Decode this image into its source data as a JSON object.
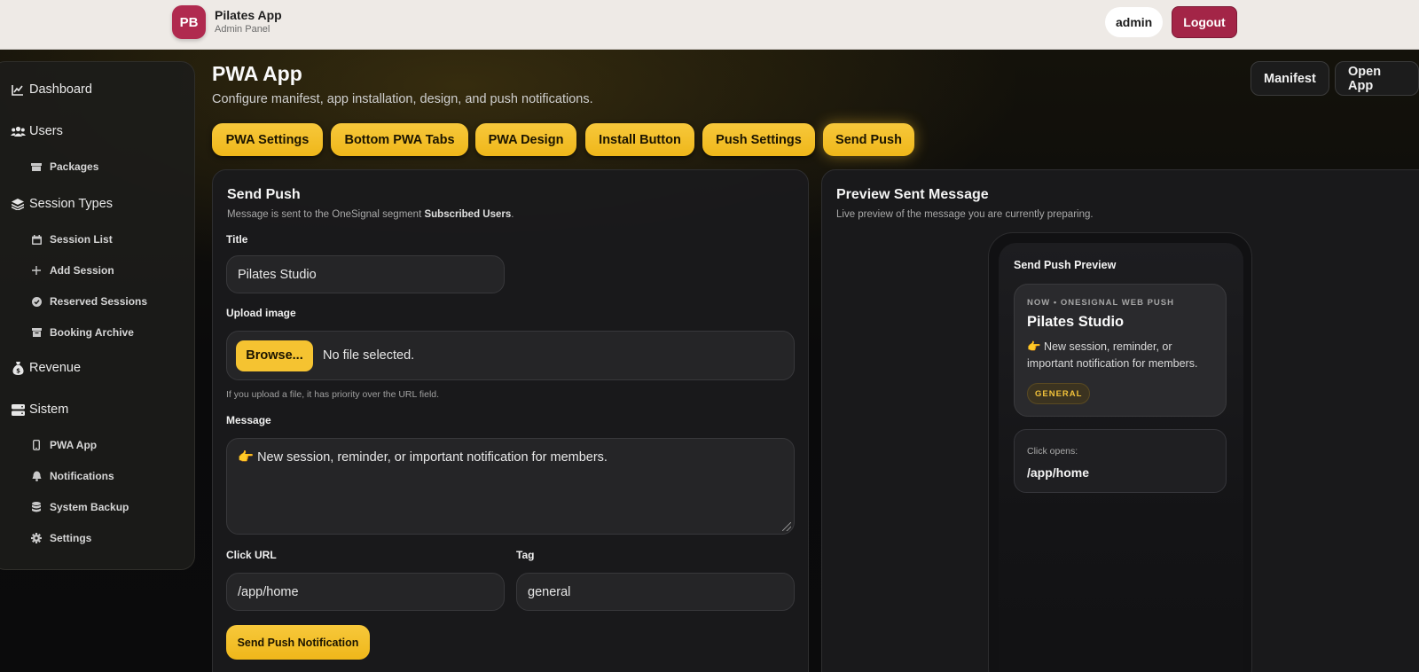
{
  "topbar": {
    "logo_initials": "PB",
    "app_name": "Pilates App",
    "app_sub": "Admin Panel",
    "user": "admin",
    "logout_label": "Logout"
  },
  "sidebar": {
    "items": [
      {
        "label": "Dashboard",
        "icon": "chart-line-icon",
        "level": "main"
      },
      {
        "label": "Users",
        "icon": "users-icon",
        "level": "main"
      },
      {
        "label": "Packages",
        "icon": "box-icon",
        "level": "sub"
      },
      {
        "label": "Session Types",
        "icon": "layers-icon",
        "level": "main"
      },
      {
        "label": "Session List",
        "icon": "calendar-icon",
        "level": "sub"
      },
      {
        "label": "Add Session",
        "icon": "plus-icon",
        "level": "sub"
      },
      {
        "label": "Reserved Sessions",
        "icon": "check-circle-icon",
        "level": "sub"
      },
      {
        "label": "Booking Archive",
        "icon": "archive-icon",
        "level": "sub"
      },
      {
        "label": "Revenue",
        "icon": "money-bag-icon",
        "level": "main"
      },
      {
        "label": "Sistem",
        "icon": "server-icon",
        "level": "main"
      },
      {
        "label": "PWA App",
        "icon": "mobile-icon",
        "level": "sub"
      },
      {
        "label": "Notifications",
        "icon": "bell-icon",
        "level": "sub"
      },
      {
        "label": "System Backup",
        "icon": "database-icon",
        "level": "sub"
      },
      {
        "label": "Settings",
        "icon": "gear-icon",
        "level": "sub"
      }
    ]
  },
  "page": {
    "title": "PWA App",
    "subtitle": "Configure manifest, app installation, design, and push notifications.",
    "manifest_label": "Manifest",
    "open_app_label": "Open App"
  },
  "tabs": [
    {
      "label": "PWA Settings"
    },
    {
      "label": "Bottom PWA Tabs"
    },
    {
      "label": "PWA Design"
    },
    {
      "label": "Install Button"
    },
    {
      "label": "Push Settings"
    },
    {
      "label": "Send Push"
    }
  ],
  "send_push": {
    "title": "Send Push",
    "desc_prefix": "Message is sent to the OneSignal segment ",
    "desc_segment": "Subscribed Users",
    "desc_suffix": ".",
    "title_label": "Title",
    "title_value": "Pilates Studio",
    "upload_label": "Upload image",
    "browse_label": "Browse...",
    "file_status": "No file selected.",
    "upload_hint": "If you upload a file, it has priority over the URL field.",
    "message_label": "Message",
    "message_value": "👉 New session, reminder, or important notification for members.",
    "click_url_label": "Click URL",
    "click_url_value": "/app/home",
    "tag_label": "Tag",
    "tag_value": "general",
    "send_label": "Send Push Notification"
  },
  "preview": {
    "title": "Preview Sent Message",
    "subtitle": "Live preview of the message you are currently preparing.",
    "phone_title": "Send Push Preview",
    "meta": "NOW • ONESIGNAL WEB PUSH",
    "notif_title": "Pilates Studio",
    "notif_body": "👉 New session, reminder, or important notification for members.",
    "tag": "GENERAL",
    "click_opens_label": "Click opens:",
    "click_opens_url": "/app/home"
  },
  "colors": {
    "accent": "#f5c331",
    "brand": "#b02a4f",
    "background": "#0b0b0c"
  }
}
